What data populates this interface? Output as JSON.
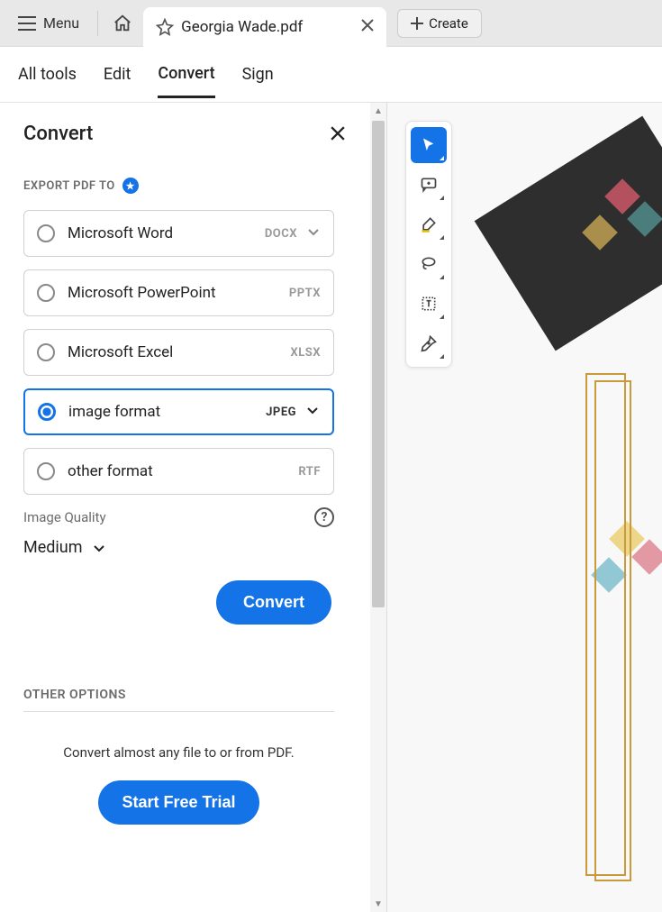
{
  "topbar": {
    "menu_label": "Menu",
    "tab_title": "Georgia Wade.pdf",
    "create_label": "Create"
  },
  "toolsrow": {
    "all_tools": "All tools",
    "edit": "Edit",
    "convert": "Convert",
    "sign": "Sign"
  },
  "panel": {
    "title": "Convert",
    "export_label": "EXPORT PDF TO",
    "options": [
      {
        "label": "Microsoft Word",
        "fmt": "DOCX",
        "selected": false,
        "dropdown": true
      },
      {
        "label": "Microsoft PowerPoint",
        "fmt": "PPTX",
        "selected": false,
        "dropdown": false
      },
      {
        "label": "Microsoft Excel",
        "fmt": "XLSX",
        "selected": false,
        "dropdown": false
      },
      {
        "label": "image format",
        "fmt": "JPEG",
        "selected": true,
        "dropdown": true
      },
      {
        "label": "other format",
        "fmt": "RTF",
        "selected": false,
        "dropdown": false
      }
    ],
    "quality_label": "Image Quality",
    "quality_value": "Medium",
    "convert_btn": "Convert",
    "other_label": "OTHER OPTIONS",
    "other_text": "Convert almost any file to or from PDF.",
    "trial_btn": "Start Free Trial"
  }
}
